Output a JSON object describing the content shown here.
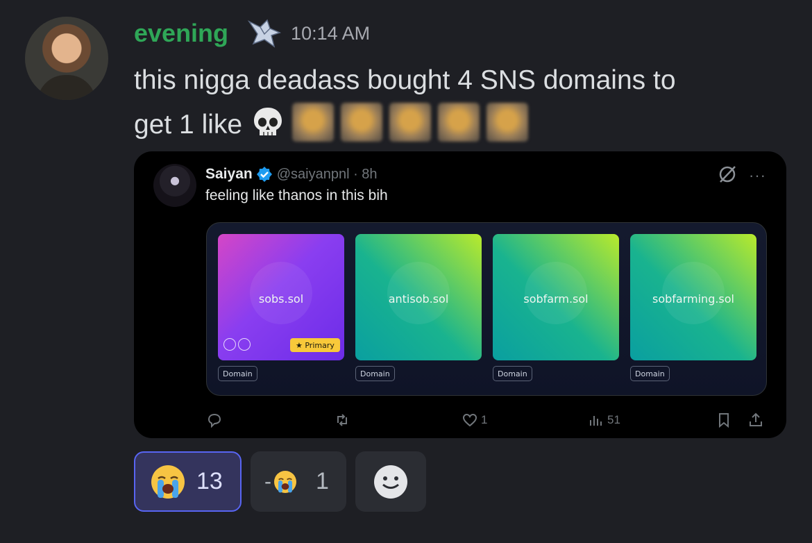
{
  "message": {
    "username": "evening",
    "role_icon": "wolf-head-icon",
    "timestamp": "10:14 AM",
    "text_line1": "this nigga deadass bought 4 SNS domains to",
    "text_line2": "get 1 like"
  },
  "embed": {
    "author_name": "Saiyan",
    "author_handle_time": "@saiyanpnl · 8h",
    "tweet_text": "feeling like thanos in this bih",
    "cards": [
      {
        "label": "sobs.sol",
        "tag": "Domain",
        "badge": "★ Primary"
      },
      {
        "label": "antisob.sol",
        "tag": "Domain"
      },
      {
        "label": "sobfarm.sol",
        "tag": "Domain"
      },
      {
        "label": "sobfarming.sol",
        "tag": "Domain"
      }
    ],
    "actions": {
      "likes": "1",
      "views": "51"
    }
  },
  "reactions": [
    {
      "emoji": "loudly-crying-face",
      "count": "13",
      "active": true
    },
    {
      "prefix": "-",
      "emoji": "loudly-crying-face",
      "count": "1",
      "active": false
    }
  ],
  "colors": {
    "username": "#2fa657",
    "background": "#1e1f24",
    "reaction_active_border": "#5865f2"
  }
}
